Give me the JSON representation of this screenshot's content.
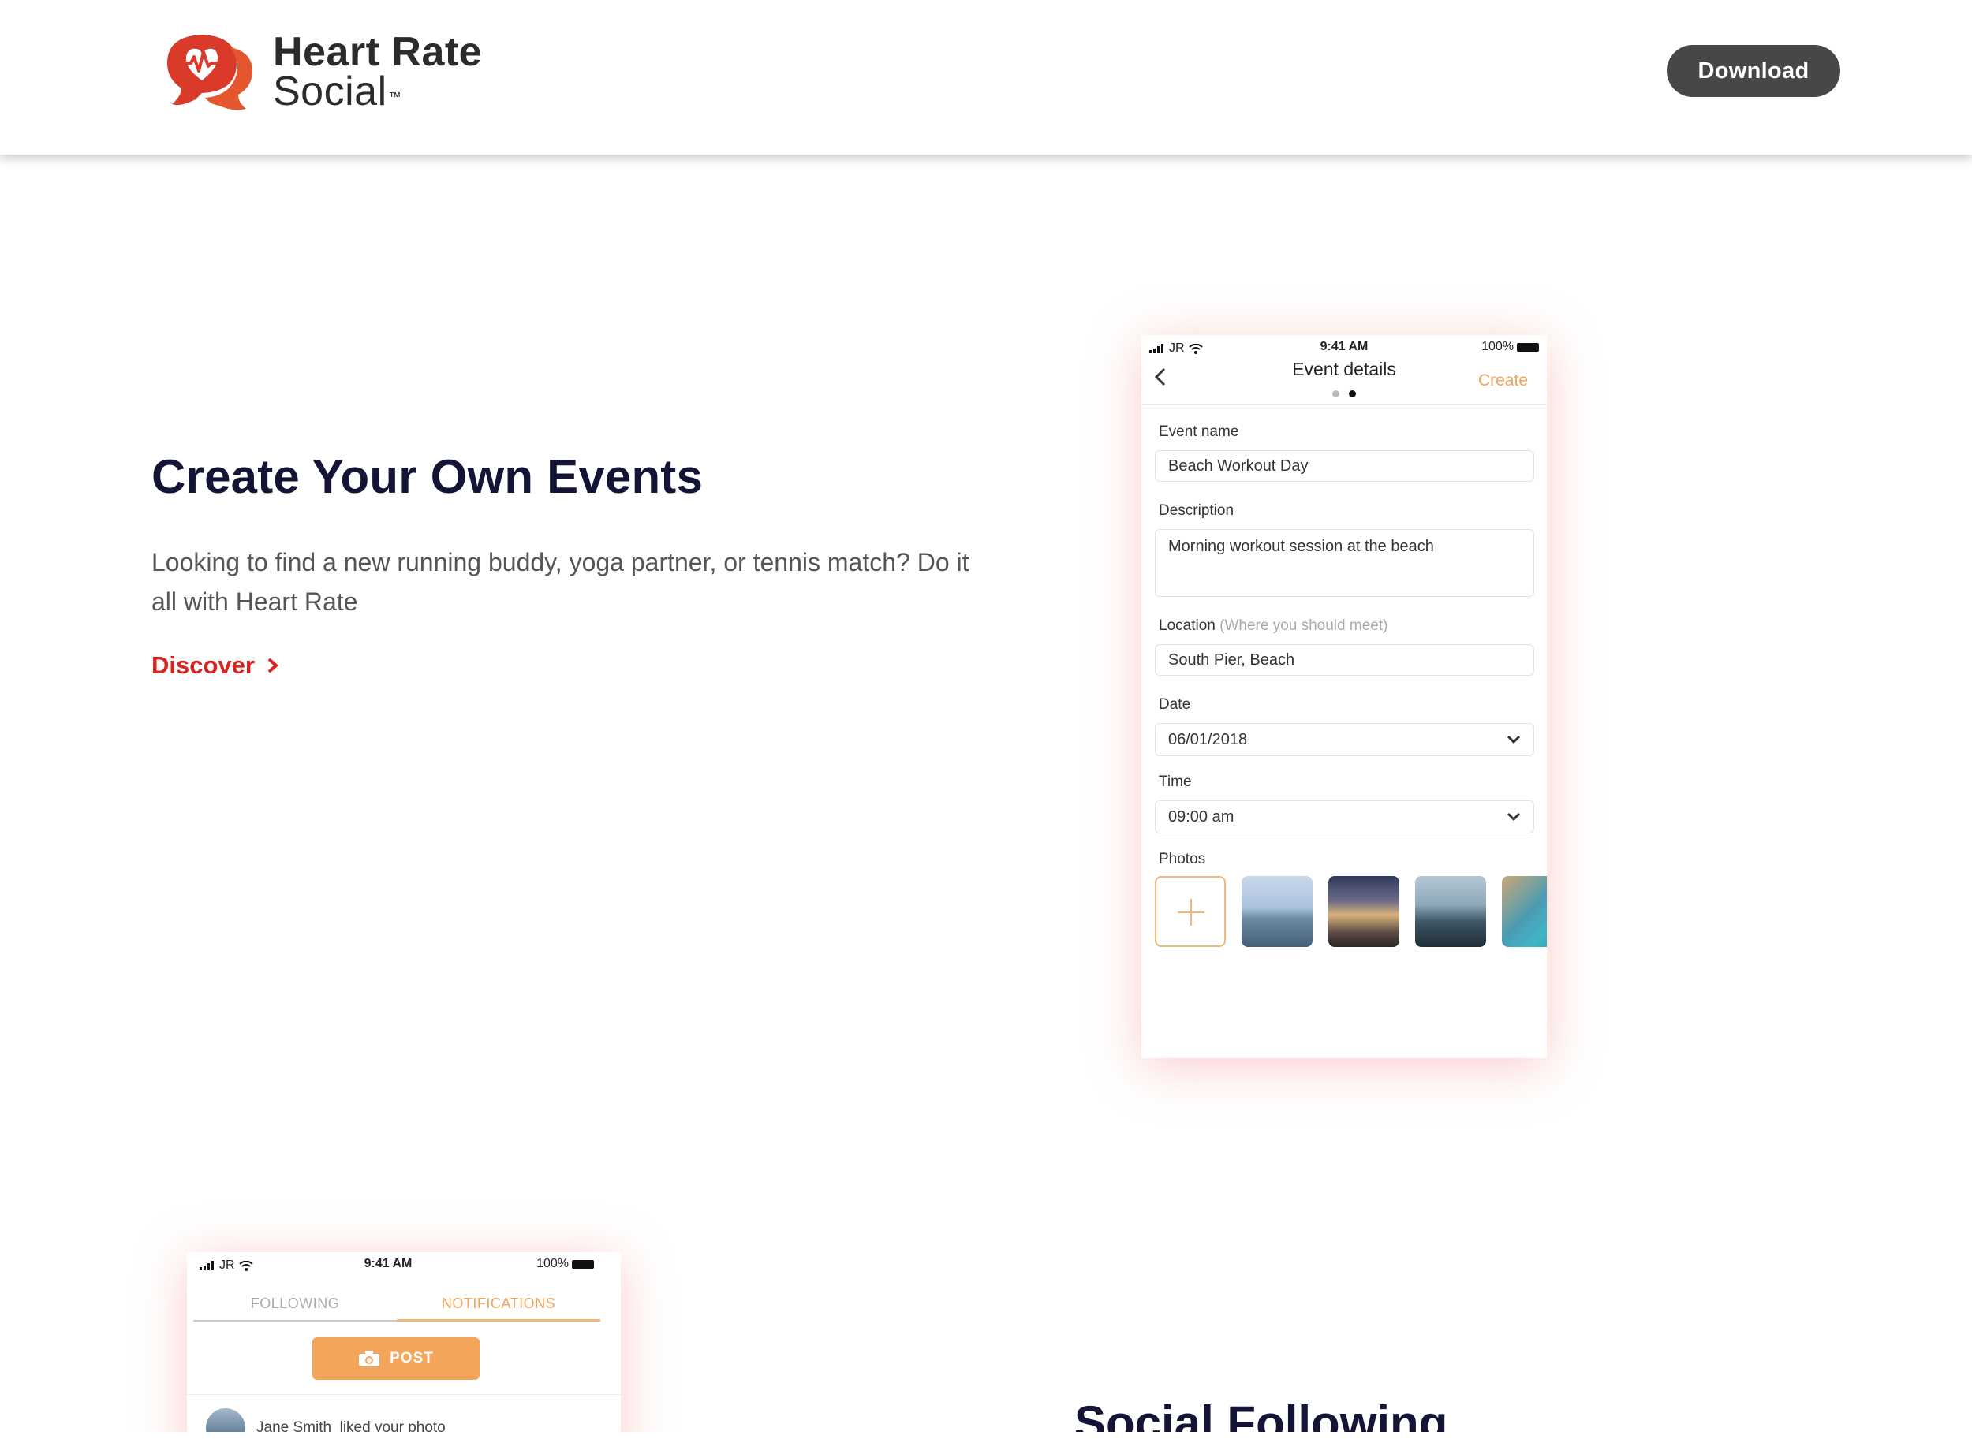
{
  "header": {
    "logo_line1": "Heart Rate",
    "logo_line2": "Social",
    "logo_tm": "™",
    "download_label": "Download"
  },
  "hero": {
    "title": "Create Your Own Events",
    "description": "Looking to find a new running buddy, yoga partner, or tennis match? Do it all with Heart Rate",
    "cta_label": "Discover"
  },
  "phone1": {
    "status": {
      "signal": "JR",
      "time": "9:41 AM",
      "battery": "100%"
    },
    "nav_title": "Event details",
    "create_label": "Create",
    "fields": {
      "event_name_label": "Event name",
      "event_name_value": "Beach Workout Day",
      "description_label": "Description",
      "description_value": "Morning workout session at the beach",
      "location_label": "Location",
      "location_hint": "(Where you should meet)",
      "location_value": "South Pier, Beach",
      "date_label": "Date",
      "date_value": "06/01/2018",
      "time_label": "Time",
      "time_value": "09:00 am",
      "photos_label": "Photos"
    }
  },
  "phone2": {
    "status": {
      "signal": "JR",
      "time": "9:41 AM",
      "battery": "100%"
    },
    "tabs": [
      "FOLLOWING",
      "NOTIFICATIONS"
    ],
    "post_label": "POST",
    "notification_name": "Jane Smith",
    "notification_text": "liked your photo"
  },
  "section2": {
    "title": "Social Following"
  },
  "colors": {
    "brand_red": "#d6241e",
    "accent_orange": "#f4a55c",
    "heading_navy": "#141437",
    "button_dark": "#474747"
  }
}
